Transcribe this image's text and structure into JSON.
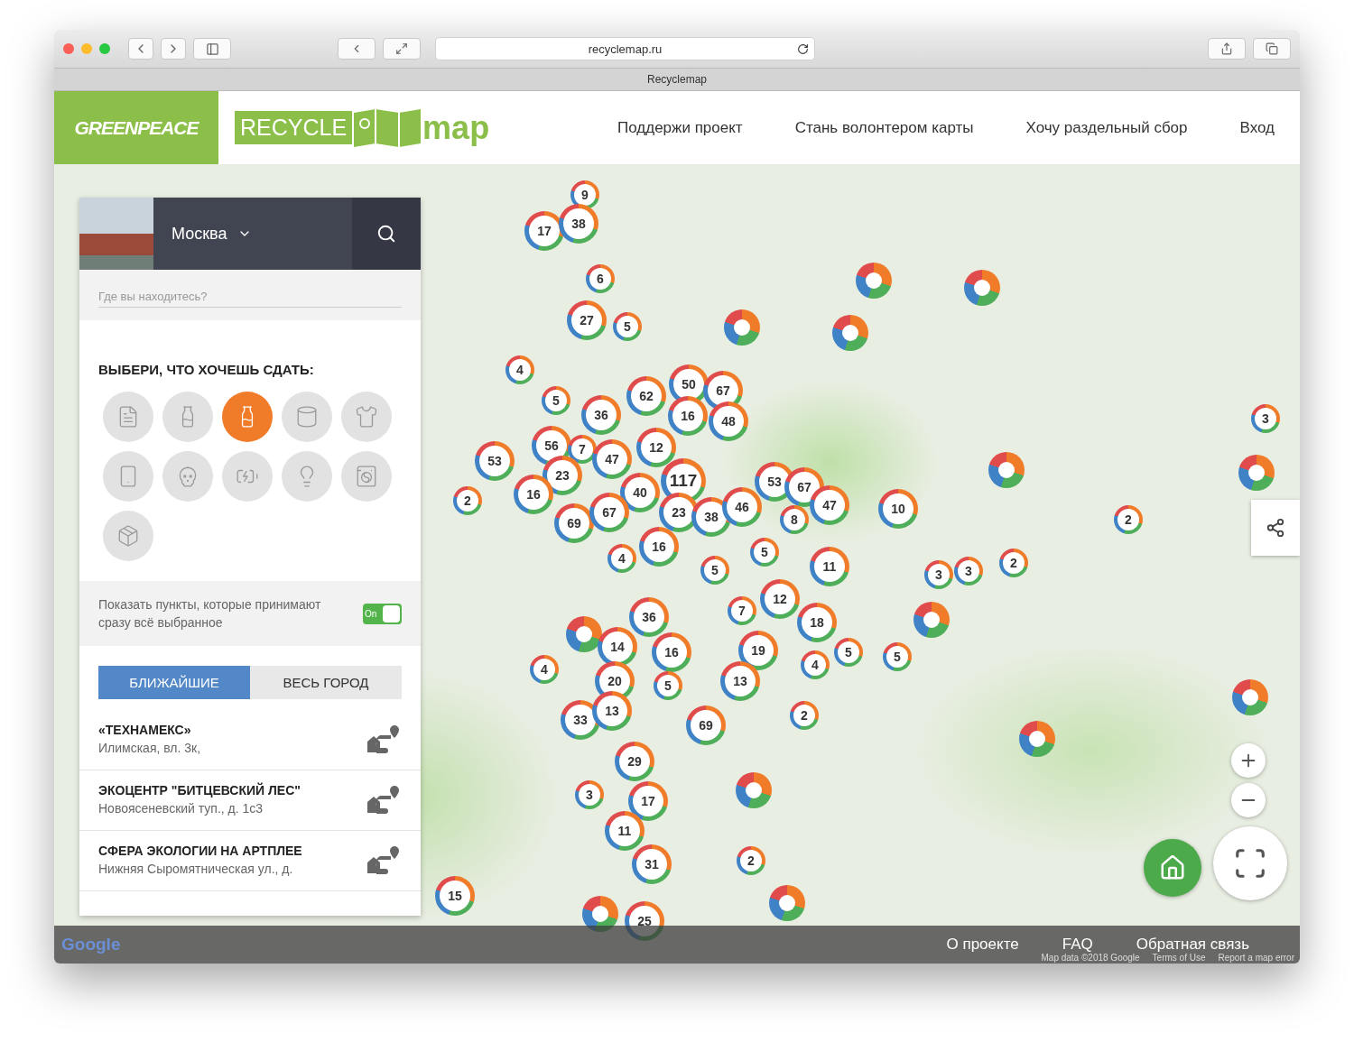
{
  "browser": {
    "url": "recyclemap.ru",
    "tab_title": "Recyclemap"
  },
  "header": {
    "greenpeace_logo": "GREENPEACE",
    "logo_box": "RECYCLE",
    "logo_word": "map",
    "nav": [
      "Поддержи проект",
      "Стань волонтером карты",
      "Хочу раздельный сбор",
      "Вход"
    ]
  },
  "sidebar": {
    "city": "Москва",
    "location_placeholder": "Где вы находитесь?",
    "choose_title": "ВЫБЕРИ, ЧТО ХОЧЕШЬ СДАТЬ:",
    "categories": [
      {
        "selected": false
      },
      {
        "selected": false
      },
      {
        "selected": true
      },
      {
        "selected": false
      },
      {
        "selected": false
      },
      {
        "selected": false
      },
      {
        "selected": false
      },
      {
        "selected": false
      },
      {
        "selected": false
      },
      {
        "selected": false
      },
      {
        "selected": false
      }
    ],
    "filter_text": "Показать пункты, которые принимают сразу всё выбранное",
    "toggle": {
      "label": "On",
      "on": true
    },
    "tabs": [
      {
        "label": "БЛИЖАЙШИЕ",
        "selected": true
      },
      {
        "label": "ВЕСЬ ГОРОД",
        "selected": false
      }
    ],
    "points": [
      {
        "name": "«ТЕХНАМЕКС»",
        "address": "Илимская, вл. 3к,"
      },
      {
        "name": "ЭКОЦЕНТР \"БИТЦЕВСКИЙ ЛЕС\"",
        "address": "Новоясеневский туп., д. 1с3"
      },
      {
        "name": "СФЕРА ЭКОЛОГИИ НА АРТПЛЕЕ",
        "address": "Нижняя Сыромятническая ул., д."
      }
    ]
  },
  "map": {
    "clusters": [
      "9",
      "17",
      "38",
      "6",
      "27",
      "5",
      "4",
      "5",
      "50",
      "62",
      "67",
      "36",
      "16",
      "48",
      "56",
      "7",
      "47",
      "12",
      "53",
      "23",
      "117",
      "16",
      "2",
      "40",
      "53",
      "67",
      "47",
      "10",
      "69",
      "67",
      "23",
      "38",
      "46",
      "8",
      "16",
      "4",
      "5",
      "5",
      "11",
      "3",
      "3",
      "2",
      "3",
      "2",
      "36",
      "12",
      "7",
      "18",
      "14",
      "16",
      "19",
      "5",
      "5",
      "4",
      "20",
      "5",
      "13",
      "4",
      "33",
      "13",
      "69",
      "2",
      "29",
      "3",
      "17",
      "11",
      "31",
      "2",
      "15",
      "25"
    ],
    "google_logo": "Google",
    "attribution": [
      "Map data ©2018 Google",
      "Terms of Use",
      "Report a map error"
    ]
  },
  "footer": {
    "links": [
      "О проекте",
      "FAQ",
      "Обратная связь"
    ]
  }
}
